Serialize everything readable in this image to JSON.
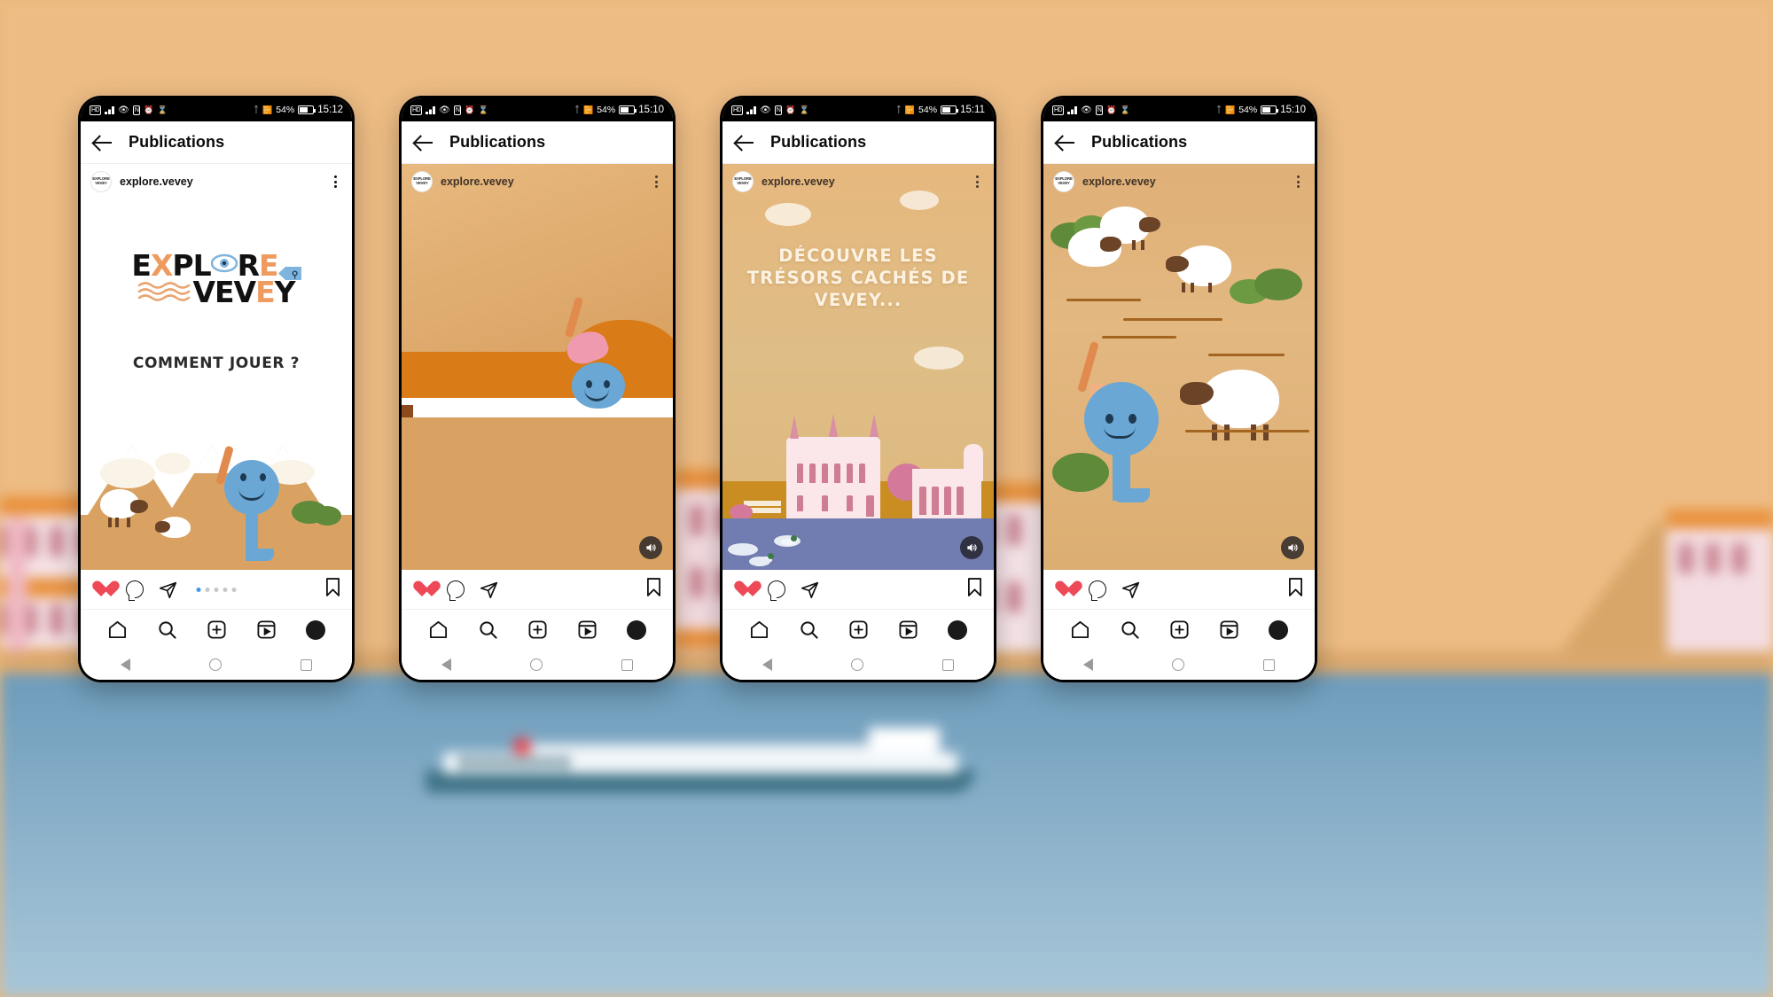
{
  "background": {
    "description": "blurred illustrated lakeside town scene",
    "sky_color": "#edbc84",
    "lake_color": "#8fb4cc",
    "building_color": "#f2dce0",
    "roof_color": "#e9913c",
    "boat_hull_color": "#3f7387"
  },
  "phones": [
    {
      "id": "phone-1",
      "statusbar": {
        "carrier_icon": "hd-icon",
        "signal_icon": "signal-bars-icon",
        "eye_icon": "eye-icon",
        "nfc_icon": "nfc-icon",
        "alarm_icon": "alarm-icon",
        "hourglass_icon": "hourglass-icon",
        "bluetooth_icon": "bluetooth-icon",
        "vibrate_icon": "vibrate-icon",
        "battery_pct": "54%",
        "battery_icon": "battery-icon",
        "time": "15:12"
      },
      "header": {
        "back_icon": "back-arrow-icon",
        "title": "Publications"
      },
      "post": {
        "avatar_label": "EXPLORE VEVEY",
        "username": "explore.vevey",
        "menu_icon": "more-options-icon"
      },
      "slide": {
        "type": "logo",
        "logo_line1": "EXPLORE",
        "logo_line2": "VEVEY",
        "caption": "COMMENT JOUER ?",
        "eye_icon": "eye-in-letter-o-icon",
        "wave_icon": "wave-lines-icon",
        "fish_icon": "fish-arrow-icon"
      },
      "actions": {
        "like_icon": "heart-filled-icon",
        "comment_icon": "comment-bubble-icon",
        "share_icon": "share-paperplane-icon",
        "save_icon": "bookmark-icon",
        "carousel_dots": 5,
        "carousel_active_index": 0,
        "accent_color": "#3897f0",
        "like_color": "#ed4956"
      },
      "has_mute_button": false,
      "tabbar": {
        "home_icon": "home-icon",
        "search_icon": "search-icon",
        "create_icon": "add-post-icon",
        "reels_icon": "reels-icon",
        "profile_icon": "profile-avatar-icon"
      },
      "navbar": {
        "back_icon": "android-back-icon",
        "home_icon": "android-home-icon",
        "recents_icon": "android-recents-icon"
      }
    },
    {
      "id": "phone-2",
      "statusbar": {
        "carrier_icon": "hd-icon",
        "signal_icon": "signal-bars-icon",
        "eye_icon": "eye-icon",
        "nfc_icon": "nfc-icon",
        "alarm_icon": "alarm-icon",
        "hourglass_icon": "hourglass-icon",
        "bluetooth_icon": "bluetooth-icon",
        "vibrate_icon": "vibrate-icon",
        "battery_pct": "54%",
        "battery_icon": "battery-icon",
        "time": "15:10"
      },
      "header": {
        "back_icon": "back-arrow-icon",
        "title": "Publications"
      },
      "post": {
        "avatar_label": "EXPLORE VEVEY",
        "username": "explore.vevey",
        "menu_icon": "more-options-icon"
      },
      "slide": {
        "type": "bed-scene",
        "caption": ""
      },
      "actions": {
        "like_icon": "heart-filled-icon",
        "comment_icon": "comment-bubble-icon",
        "share_icon": "share-paperplane-icon",
        "save_icon": "bookmark-icon",
        "carousel_dots": 0,
        "carousel_active_index": 0,
        "accent_color": "#3897f0",
        "like_color": "#ed4956"
      },
      "has_mute_button": true,
      "mute_icon": "speaker-on-icon",
      "tabbar": {
        "home_icon": "home-icon",
        "search_icon": "search-icon",
        "create_icon": "add-post-icon",
        "reels_icon": "reels-icon",
        "profile_icon": "profile-avatar-icon"
      },
      "navbar": {
        "back_icon": "android-back-icon",
        "home_icon": "android-home-icon",
        "recents_icon": "android-recents-icon"
      }
    },
    {
      "id": "phone-3",
      "statusbar": {
        "carrier_icon": "hd-icon",
        "signal_icon": "signal-bars-icon",
        "eye_icon": "eye-icon",
        "nfc_icon": "nfc-icon",
        "alarm_icon": "alarm-icon",
        "hourglass_icon": "hourglass-icon",
        "bluetooth_icon": "bluetooth-icon",
        "vibrate_icon": "vibrate-icon",
        "battery_pct": "54%",
        "battery_icon": "battery-icon",
        "time": "15:11"
      },
      "header": {
        "back_icon": "back-arrow-icon",
        "title": "Publications"
      },
      "post": {
        "avatar_label": "EXPLORE VEVEY",
        "username": "explore.vevey",
        "menu_icon": "more-options-icon"
      },
      "slide": {
        "type": "headline-city",
        "headline": "DÉCOUVRE LES TRÉSORS CACHÉS DE VEVEY...",
        "headline_color": "#fdf2e2",
        "lake_color": "#717cb0"
      },
      "actions": {
        "like_icon": "heart-filled-icon",
        "comment_icon": "comment-bubble-icon",
        "share_icon": "share-paperplane-icon",
        "save_icon": "bookmark-icon",
        "carousel_dots": 0,
        "carousel_active_index": 0,
        "accent_color": "#3897f0",
        "like_color": "#ed4956"
      },
      "has_mute_button": true,
      "mute_icon": "speaker-on-icon",
      "tabbar": {
        "home_icon": "home-icon",
        "search_icon": "search-icon",
        "create_icon": "add-post-icon",
        "reels_icon": "reels-icon",
        "profile_icon": "profile-avatar-icon"
      },
      "navbar": {
        "back_icon": "android-back-icon",
        "home_icon": "android-home-icon",
        "recents_icon": "android-recents-icon"
      }
    },
    {
      "id": "phone-4",
      "statusbar": {
        "carrier_icon": "hd-icon",
        "signal_icon": "signal-bars-icon",
        "eye_icon": "eye-icon",
        "nfc_icon": "nfc-icon",
        "alarm_icon": "alarm-icon",
        "hourglass_icon": "hourglass-icon",
        "bluetooth_icon": "bluetooth-icon",
        "vibrate_icon": "vibrate-icon",
        "battery_pct": "54%",
        "battery_icon": "battery-icon",
        "time": "15:10"
      },
      "header": {
        "back_icon": "back-arrow-icon",
        "title": "Publications"
      },
      "post": {
        "avatar_label": "EXPLORE VEVEY",
        "username": "explore.vevey",
        "menu_icon": "more-options-icon"
      },
      "slide": {
        "type": "hillside-sheep",
        "caption": ""
      },
      "actions": {
        "like_icon": "heart-filled-icon",
        "comment_icon": "comment-bubble-icon",
        "share_icon": "share-paperplane-icon",
        "save_icon": "bookmark-icon",
        "carousel_dots": 0,
        "carousel_active_index": 0,
        "accent_color": "#3897f0",
        "like_color": "#ed4956"
      },
      "has_mute_button": true,
      "mute_icon": "speaker-on-icon",
      "tabbar": {
        "home_icon": "home-icon",
        "search_icon": "search-icon",
        "create_icon": "add-post-icon",
        "reels_icon": "reels-icon",
        "profile_icon": "profile-avatar-icon"
      },
      "navbar": {
        "back_icon": "android-back-icon",
        "home_icon": "android-home-icon",
        "recents_icon": "android-recents-icon"
      }
    }
  ]
}
